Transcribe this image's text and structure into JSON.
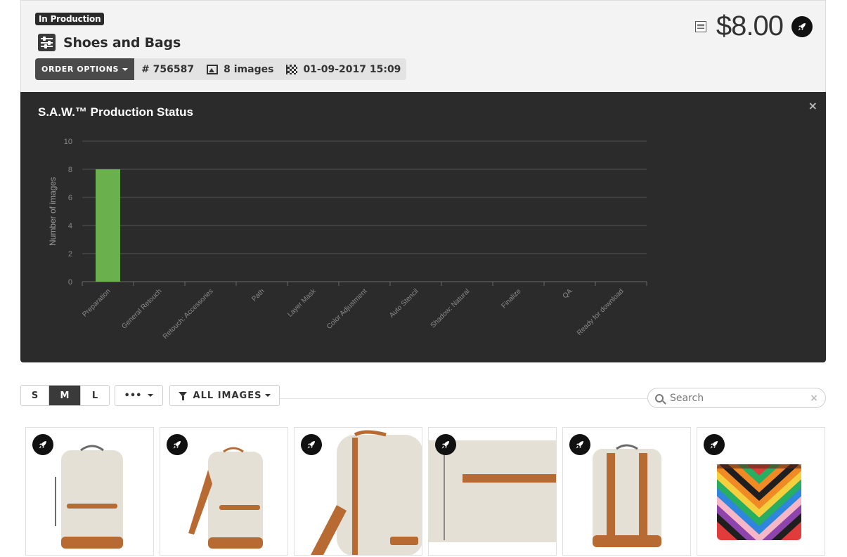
{
  "order": {
    "status": "In Production",
    "title": "Shoes and Bags",
    "options_label": "ORDER OPTIONS",
    "order_number": "# 756587",
    "image_count": "8 images",
    "deadline": "01-09-2017 15:09",
    "price": "$8.00"
  },
  "chart_panel": {
    "title": "S.A.W.™ Production Status",
    "close_label": "×"
  },
  "chart_data": {
    "type": "bar",
    "title": "S.A.W.™ Production Status",
    "xlabel": "",
    "ylabel": "Number of images",
    "ylim": [
      0,
      10
    ],
    "yticks": [
      0,
      2,
      4,
      6,
      8,
      10
    ],
    "grid": true,
    "categories": [
      "Preparation",
      "General Retouch",
      "Retouch: Accessories",
      "Path",
      "Layer Mask",
      "Color Adjustment",
      "Auto Stencil",
      "Shadow: Natural",
      "Finalize",
      "QA",
      "Ready for download"
    ],
    "values": [
      8,
      0,
      0,
      0,
      0,
      0,
      0,
      0,
      0,
      0,
      0
    ],
    "bar_color": "#6ab04c"
  },
  "toolbar": {
    "sizes": [
      "S",
      "M",
      "L"
    ],
    "active_size": "M",
    "more_label": "•••",
    "filter_label": "ALL IMAGES",
    "search_placeholder": "Search",
    "search_clear": "×"
  },
  "thumbnails": [
    {
      "subject": "backpack-front",
      "badge_icon": "rocket-icon"
    },
    {
      "subject": "backpack-angled",
      "badge_icon": "rocket-icon"
    },
    {
      "subject": "backpack-side-closeup",
      "badge_icon": "rocket-icon"
    },
    {
      "subject": "backpack-pocket-detail",
      "badge_icon": "rocket-icon"
    },
    {
      "subject": "backpack-back",
      "badge_icon": "rocket-icon"
    },
    {
      "subject": "striped-clutch",
      "badge_icon": "rocket-icon"
    }
  ],
  "colors": {
    "panel_bg": "#2b2b2b",
    "header_bg": "#f3f3f3",
    "bar_green": "#6ab04c",
    "canvas_beige": "#e4e0d5",
    "leather_brown": "#b86a33"
  }
}
